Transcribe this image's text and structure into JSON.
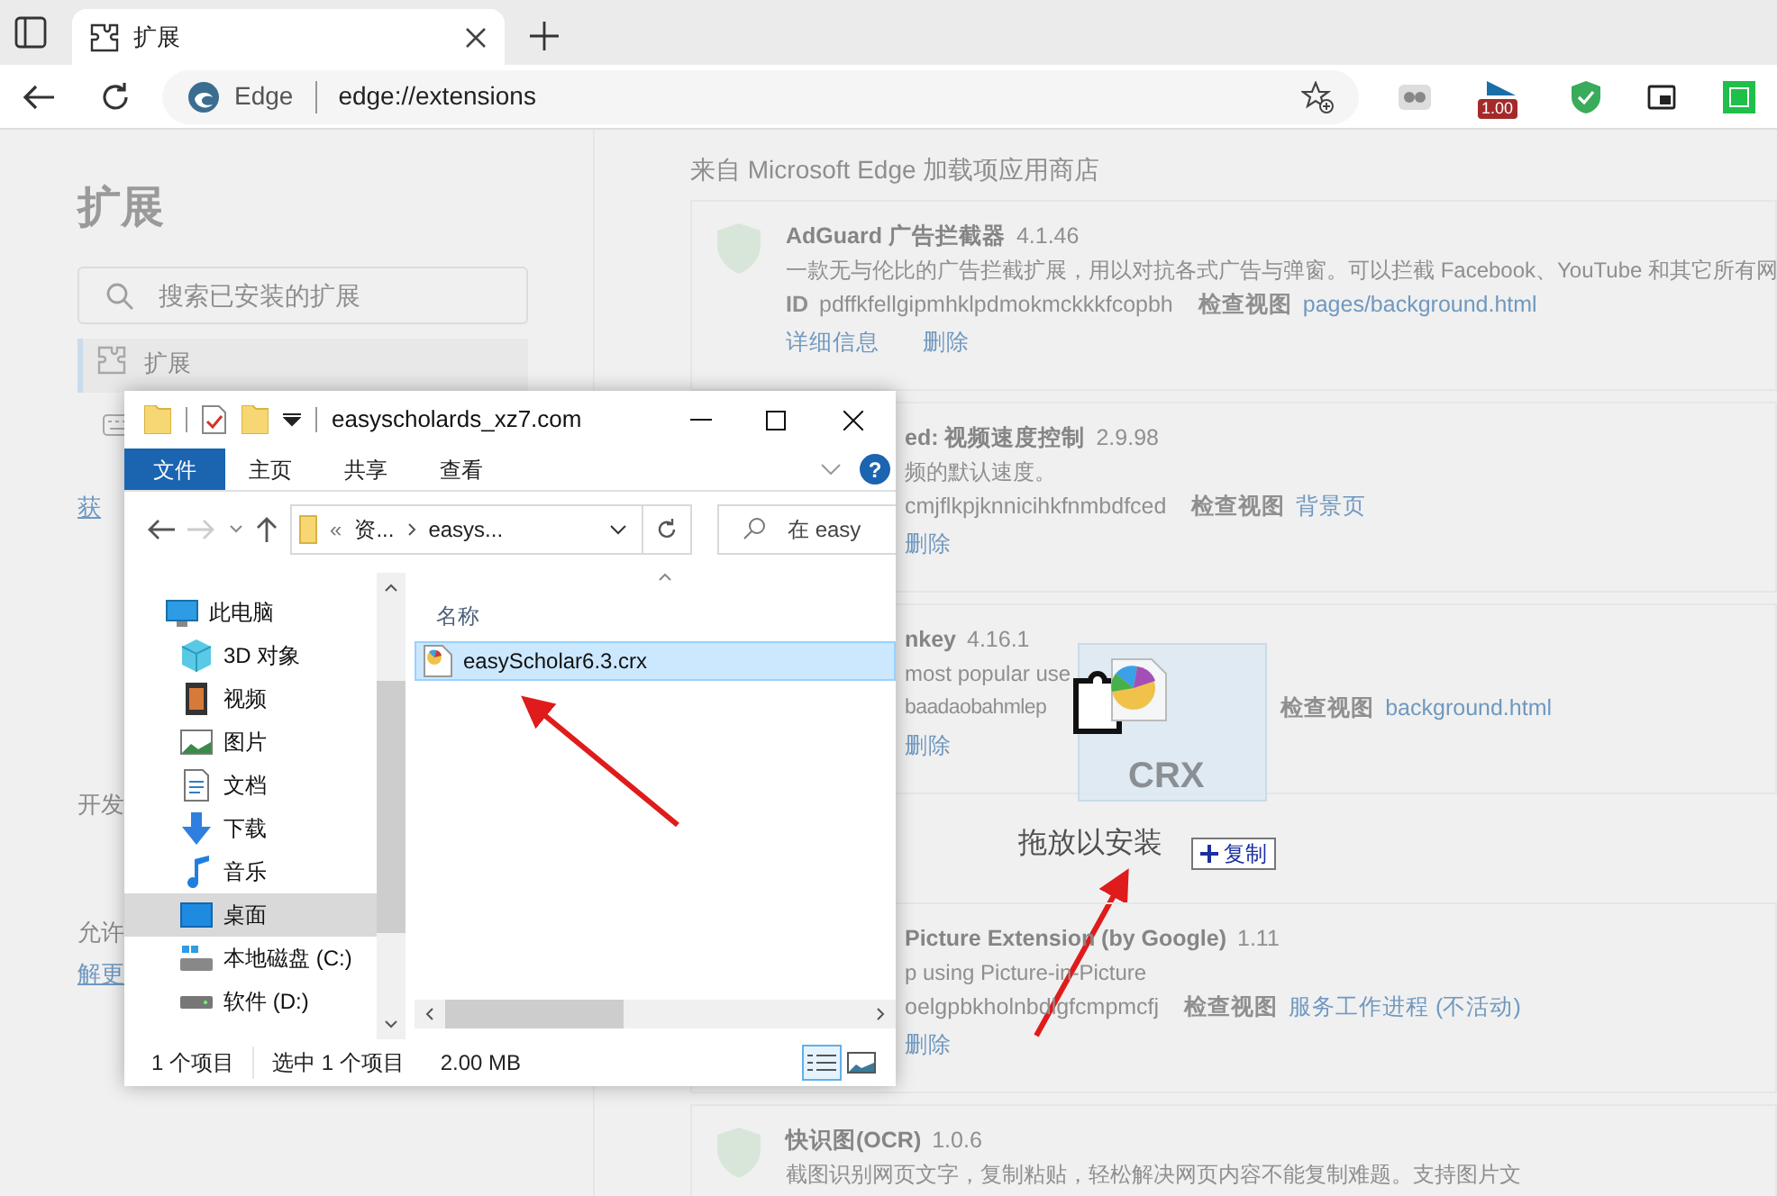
{
  "browser": {
    "tab": {
      "title": "扩展",
      "selected": true
    },
    "address": {
      "site": "Edge",
      "url": "edge://extensions"
    },
    "extension_badge": "1.00"
  },
  "sidebar": {
    "heading": "扩展",
    "search": {
      "placeholder": "搜索已安装的扩展"
    },
    "nav": [
      {
        "label": "扩展",
        "selected": true
      }
    ],
    "fragments": [
      {
        "text": "获",
        "link": true
      },
      {
        "text": "开发",
        "link": false
      },
      {
        "text": "允许",
        "link": false
      },
      {
        "text": "解更",
        "link": true
      }
    ]
  },
  "store": {
    "heading": "来自 Microsoft Edge 加载项应用商店",
    "extensions": [
      {
        "kind": "full",
        "name": "AdGuard 广告拦截器",
        "version": "4.1.46",
        "description": "一款无与伦比的广告拦截扩展，用以对抗各式广告与弹窗。可以拦截 Facebook、YouTube 和其它所有网",
        "id_label": "ID",
        "id": "pdffkfellgipmhklpdmokmckkkfcopbh",
        "inspect": "检查视图",
        "view": "pages/background.html",
        "actions": [
          "详细信息",
          "删除"
        ]
      },
      {
        "kind": "covered",
        "name": "ed: 视频速度控制",
        "version": "2.9.98",
        "description": "频的默认速度。",
        "id": "cmjflkpjknnicihkfnmbdfced",
        "inspect": "检查视图",
        "view": "背景页",
        "actions": [
          "删除"
        ]
      },
      {
        "kind": "dragged",
        "name": "nkey",
        "version": "4.16.1",
        "description": "most popular use",
        "id": "baadaobahmlep",
        "inspect": "检查视图",
        "view": "background.html",
        "actions": [
          "删除"
        ]
      },
      {
        "kind": "covered",
        "name": "Picture Extension (by Google)",
        "version": "1.11",
        "description": "p using Picture-in-Picture",
        "id": "oelgpbkholnbdlgfcmpmcfj",
        "inspect": "检查视图",
        "view": "服务工作进程 (不活动)",
        "actions": [
          "删除"
        ]
      },
      {
        "kind": "full",
        "name": "快识图(OCR)",
        "version": "1.0.6",
        "description": "截图识别网页文字，复制粘贴，轻松解决网页内容不能复制难题。支持图片文"
      }
    ]
  },
  "drop": {
    "label": "拖放以安装",
    "file_type": "CRX",
    "copy": "复制"
  },
  "explorer": {
    "title": "easyscholards_xz7.com",
    "ribbon": [
      {
        "label": "文件",
        "selected": true
      },
      {
        "label": "主页",
        "selected": false
      },
      {
        "label": "共享",
        "selected": false
      },
      {
        "label": "查看",
        "selected": false
      }
    ],
    "help": "?",
    "breadcrumb": [
      "«",
      "资...",
      "easys..."
    ],
    "search": {
      "placeholder": "在 easy"
    },
    "nav": [
      {
        "label": "此电脑",
        "selected": false,
        "children": [
          {
            "label": "3D 对象",
            "selected": false
          },
          {
            "label": "视频",
            "selected": false
          },
          {
            "label": "图片",
            "selected": false
          },
          {
            "label": "文档",
            "selected": false
          },
          {
            "label": "下载",
            "selected": false
          },
          {
            "label": "音乐",
            "selected": false
          },
          {
            "label": "桌面",
            "selected": true
          },
          {
            "label": "本地磁盘 (C:)",
            "selected": false
          },
          {
            "label": "软件 (D:)",
            "selected": false
          }
        ]
      }
    ],
    "column": "名称",
    "files": [
      {
        "name": "easyScholar6.3.crx",
        "selected": true
      }
    ],
    "status": [
      "1 个项目",
      "选中 1 个项目",
      "2.00 MB"
    ],
    "views": [
      {
        "selected": true
      },
      {
        "selected": false
      }
    ]
  }
}
